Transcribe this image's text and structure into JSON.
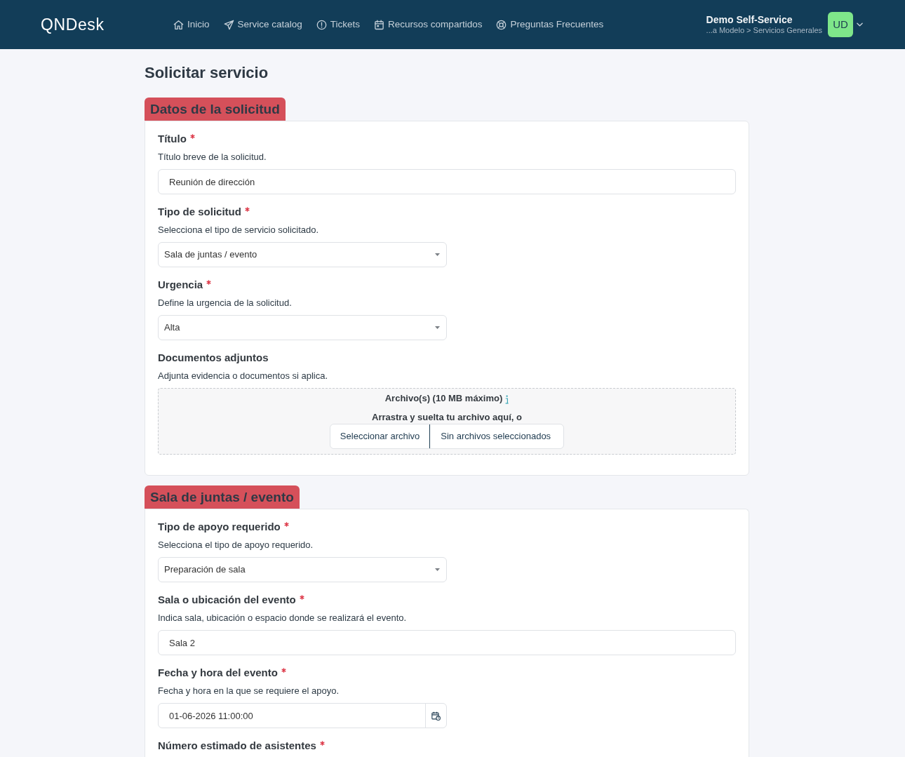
{
  "navbar": {
    "brand": "QNDesk",
    "links": [
      {
        "label": "Inicio"
      },
      {
        "label": "Service catalog"
      },
      {
        "label": "Tickets"
      },
      {
        "label": "Recursos compartidos"
      },
      {
        "label": "Preguntas Frecuentes"
      }
    ],
    "user": {
      "name": "Demo Self-Service",
      "path": "...a Modelo > Servicios Generales",
      "initials": "UD"
    }
  },
  "page_title": "Solicitar servicio",
  "sections": [
    {
      "title": "Datos de la solicitud",
      "fields": [
        {
          "kind": "text",
          "label": "Título",
          "required": true,
          "help": "Título breve de la solicitud.",
          "value": "Reunión de dirección"
        },
        {
          "kind": "select",
          "label": "Tipo de solicitud",
          "required": true,
          "help": "Selecciona el tipo de servicio solicitado.",
          "value": "Sala de juntas / evento"
        },
        {
          "kind": "select",
          "label": "Urgencia",
          "required": true,
          "help": "Define la urgencia de la solicitud.",
          "value": "Alta"
        },
        {
          "kind": "file",
          "label": "Documentos adjuntos",
          "required": false,
          "help": "Adjunta evidencia o documentos si aplica.",
          "dropzone": {
            "title": "Archivo(s) (10 MB máximo)",
            "hint": "Arrastra y suelta tu archivo aquí, o",
            "button": "Seleccionar archivo",
            "status": "Sin archivos seleccionados"
          }
        }
      ]
    },
    {
      "title": "Sala de juntas / evento",
      "fields": [
        {
          "kind": "select",
          "label": "Tipo de apoyo requerido",
          "required": true,
          "help": "Selecciona el tipo de apoyo requerido.",
          "value": "Preparación de sala"
        },
        {
          "kind": "text",
          "label": "Sala o ubicación del evento",
          "required": true,
          "help": "Indica sala, ubicación o espacio donde se realizará el evento.",
          "value": "Sala 2"
        },
        {
          "kind": "datetime",
          "label": "Fecha y hora del evento",
          "required": true,
          "help": "Fecha y hora en la que se requiere el apoyo.",
          "value": "01-06-2026 11:00:00"
        },
        {
          "label": "Número estimado de asistentes",
          "required": true
        }
      ]
    }
  ]
}
